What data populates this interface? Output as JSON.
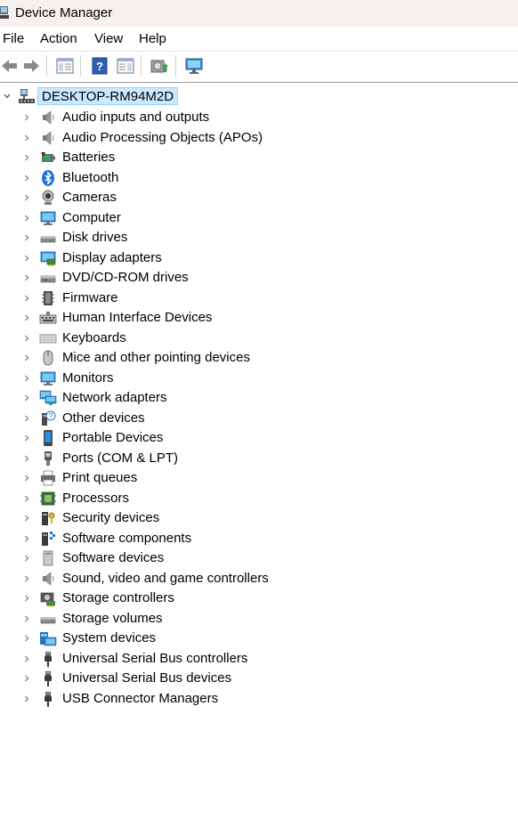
{
  "window": {
    "title": "Device Manager"
  },
  "menu": [
    {
      "label": "File"
    },
    {
      "label": "Action"
    },
    {
      "label": "View"
    },
    {
      "label": "Help"
    }
  ],
  "toolbar": {
    "buttons": [
      {
        "name": "back-button",
        "icon": "back-arrow-icon"
      },
      {
        "name": "forward-button",
        "icon": "forward-arrow-icon"
      },
      {
        "name": "show-hide-console-tree-button",
        "icon": "console-tree-icon"
      },
      {
        "name": "help-button",
        "icon": "help-icon"
      },
      {
        "name": "show-action-pane-button",
        "icon": "action-pane-icon"
      },
      {
        "name": "update-driver-button",
        "icon": "update-driver-icon"
      },
      {
        "name": "scan-hardware-button",
        "icon": "scan-monitor-icon"
      }
    ]
  },
  "tree": {
    "root": {
      "label": "DESKTOP-RM94M2D",
      "icon": "computer-network-icon",
      "expanded": true
    },
    "categories": [
      {
        "label": "Audio inputs and outputs",
        "icon": "speaker-icon"
      },
      {
        "label": "Audio Processing Objects (APOs)",
        "icon": "speaker-icon"
      },
      {
        "label": "Batteries",
        "icon": "battery-icon"
      },
      {
        "label": "Bluetooth",
        "icon": "bluetooth-icon"
      },
      {
        "label": "Cameras",
        "icon": "camera-icon"
      },
      {
        "label": "Computer",
        "icon": "monitor-icon"
      },
      {
        "label": "Disk drives",
        "icon": "disk-drive-icon"
      },
      {
        "label": "Display adapters",
        "icon": "display-adapter-icon"
      },
      {
        "label": "DVD/CD-ROM drives",
        "icon": "optical-drive-icon"
      },
      {
        "label": "Firmware",
        "icon": "firmware-icon"
      },
      {
        "label": "Human Interface Devices",
        "icon": "hid-icon"
      },
      {
        "label": "Keyboards",
        "icon": "keyboard-icon"
      },
      {
        "label": "Mice and other pointing devices",
        "icon": "mouse-icon"
      },
      {
        "label": "Monitors",
        "icon": "monitor-icon"
      },
      {
        "label": "Network adapters",
        "icon": "network-adapter-icon"
      },
      {
        "label": "Other devices",
        "icon": "unknown-device-icon"
      },
      {
        "label": "Portable Devices",
        "icon": "portable-device-icon"
      },
      {
        "label": "Ports (COM & LPT)",
        "icon": "port-icon"
      },
      {
        "label": "Print queues",
        "icon": "printer-icon"
      },
      {
        "label": "Processors",
        "icon": "processor-icon"
      },
      {
        "label": "Security devices",
        "icon": "security-device-icon"
      },
      {
        "label": "Software components",
        "icon": "software-component-icon"
      },
      {
        "label": "Software devices",
        "icon": "software-device-icon"
      },
      {
        "label": "Sound, video and game controllers",
        "icon": "speaker-icon"
      },
      {
        "label": "Storage controllers",
        "icon": "storage-controller-icon"
      },
      {
        "label": "Storage volumes",
        "icon": "disk-drive-icon"
      },
      {
        "label": "System devices",
        "icon": "system-device-icon"
      },
      {
        "label": "Universal Serial Bus controllers",
        "icon": "usb-icon"
      },
      {
        "label": "Universal Serial Bus devices",
        "icon": "usb-icon"
      },
      {
        "label": "USB Connector Managers",
        "icon": "usb-icon"
      }
    ]
  },
  "colors": {
    "selection_bg": "#cce8ff",
    "selection_border": "#99d1ff",
    "titlebar_bg": "#f6f1ee"
  }
}
